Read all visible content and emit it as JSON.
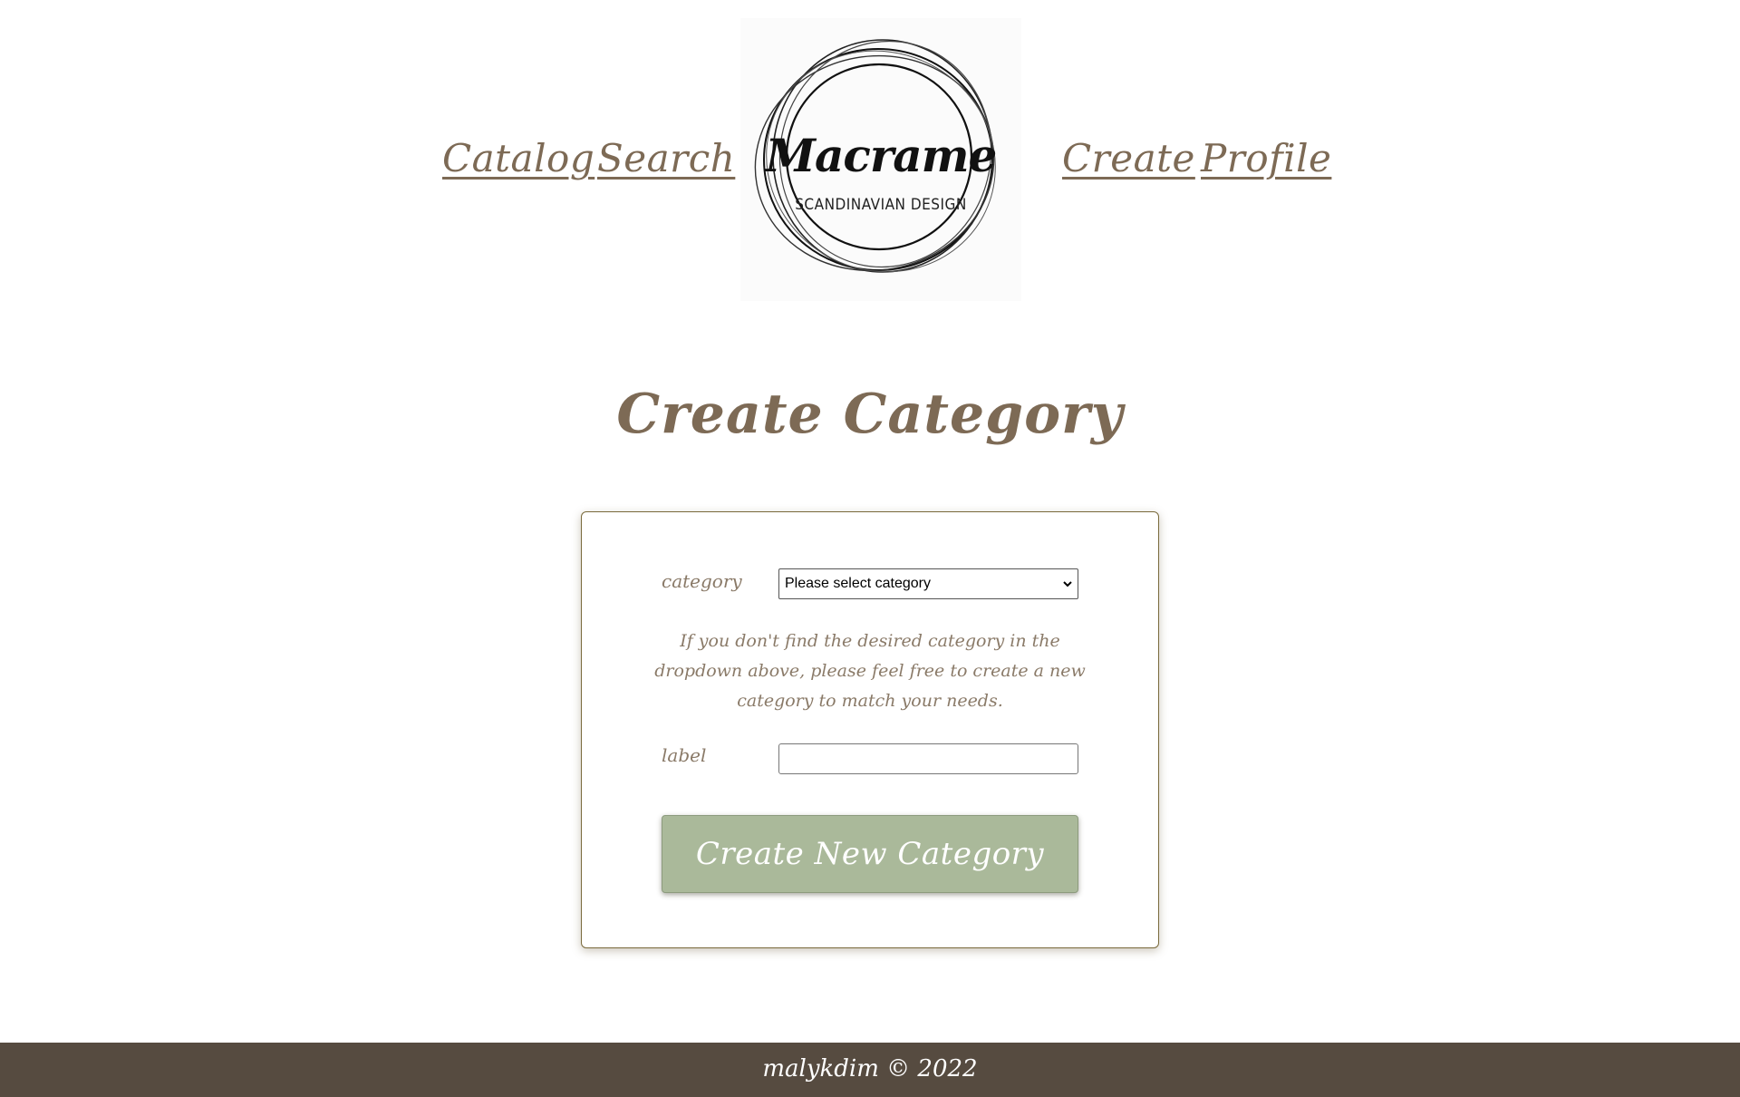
{
  "nav": {
    "left": [
      {
        "label": "Catalog"
      },
      {
        "label": "Search"
      }
    ],
    "right": [
      {
        "label": "Create"
      },
      {
        "label": "Profile"
      }
    ]
  },
  "logo": {
    "title": "Macrame",
    "subtitle": "SCANDINAVIAN DESIGN"
  },
  "page": {
    "title": "Create Category"
  },
  "form": {
    "category_label": "category",
    "category_select": {
      "selected": "Please select category"
    },
    "help_text": "If you don't find the desired category in the dropdown above, please feel free to create a new category to match your needs.",
    "label_label": "label",
    "label_input": {
      "value": "",
      "placeholder": ""
    },
    "submit_label": "Create New Category"
  },
  "footer": {
    "text": "malykdim © 2022"
  },
  "colors": {
    "brand_text": "#7d6a55",
    "button": "#aab99a",
    "footer_bg": "#564b40"
  }
}
